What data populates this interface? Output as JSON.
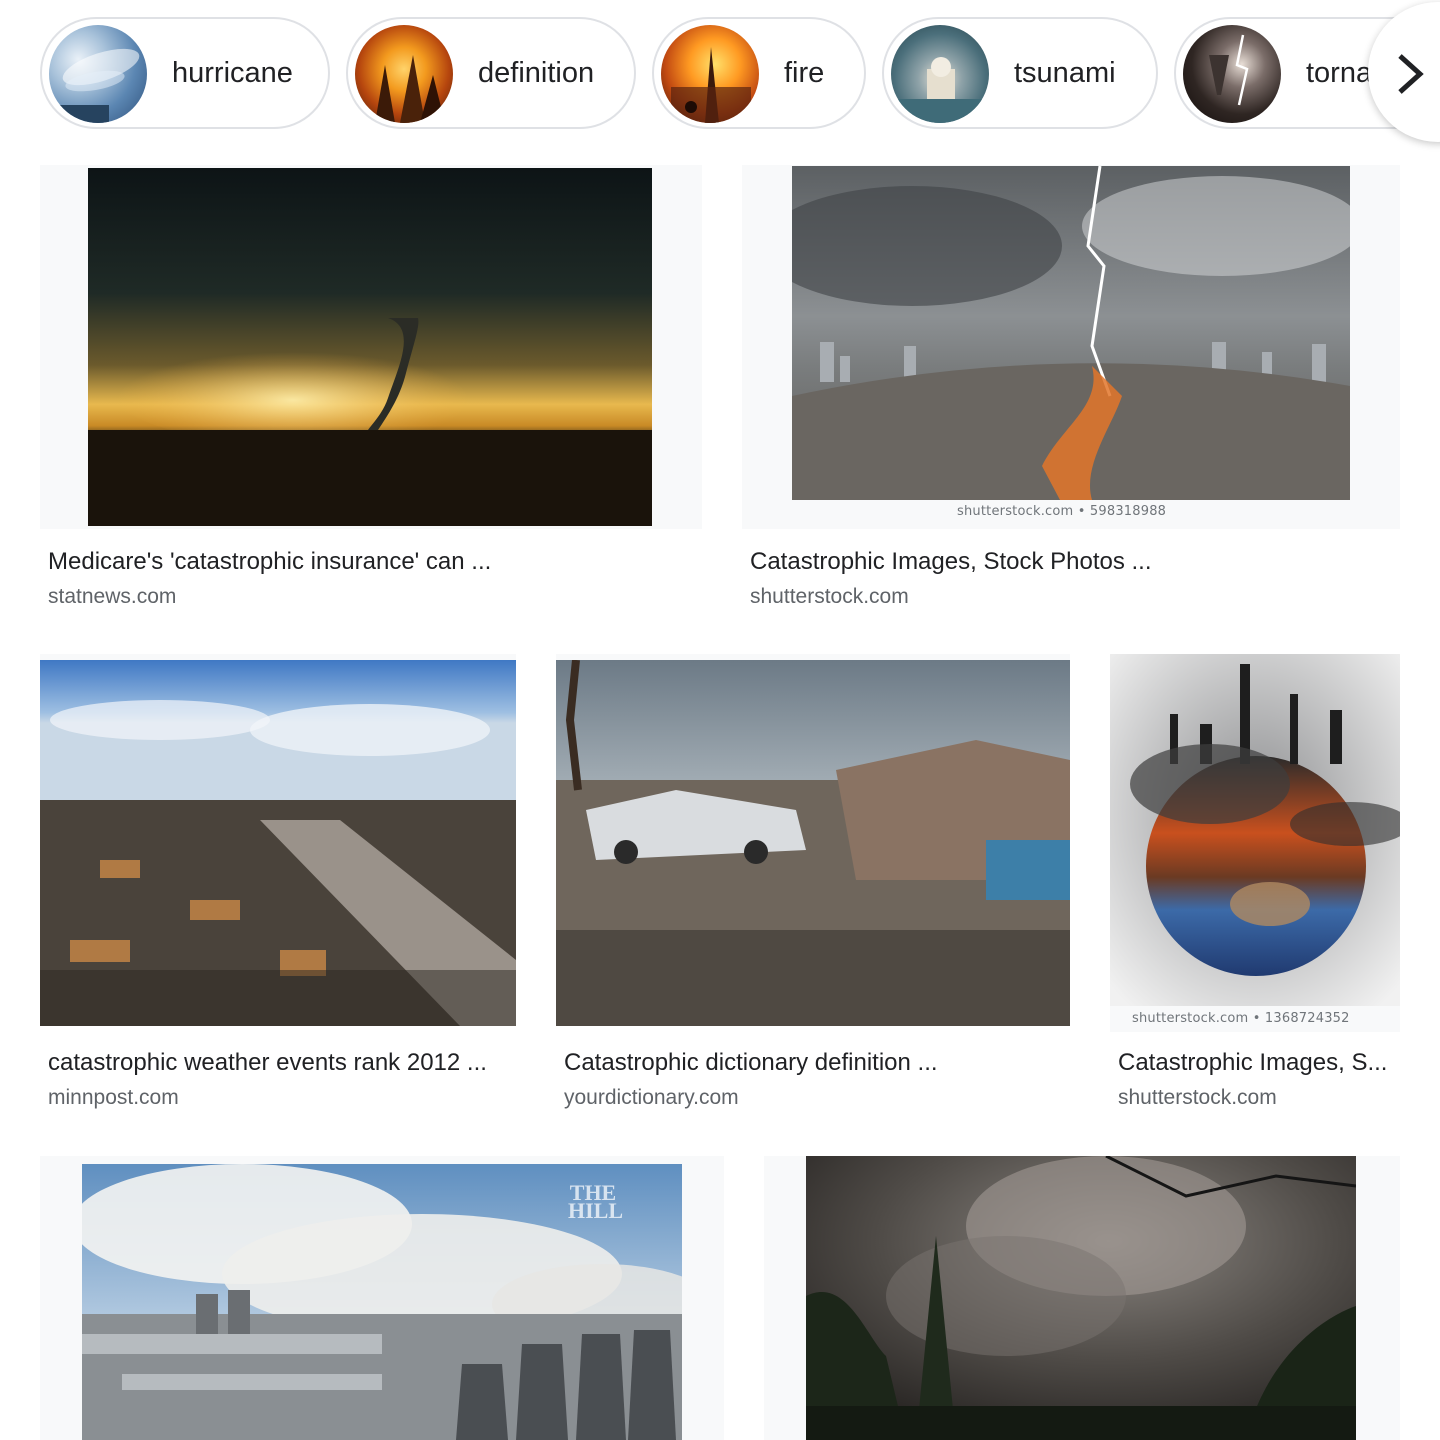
{
  "chips": [
    {
      "label": "hurricane"
    },
    {
      "label": "definition"
    },
    {
      "label": "fire"
    },
    {
      "label": "tsunami"
    },
    {
      "label": "torna"
    }
  ],
  "results": [
    {
      "title": "Medicare's 'catastrophic insurance' can ...",
      "source": "statnews.com"
    },
    {
      "title": "Catastrophic Images, Stock Photos ...",
      "source": "shutterstock.com",
      "watermark": "shutterstock.com • 598318988"
    },
    {
      "title": "catastrophic weather events rank 2012 ...",
      "source": "minnpost.com"
    },
    {
      "title": "Catastrophic dictionary definition ...",
      "source": "yourdictionary.com"
    },
    {
      "title": "Catastrophic Images, S...",
      "source": "shutterstock.com",
      "watermark": "shutterstock.com • 1368724352"
    },
    {
      "overlay_mark": "THE HILL"
    },
    {}
  ]
}
